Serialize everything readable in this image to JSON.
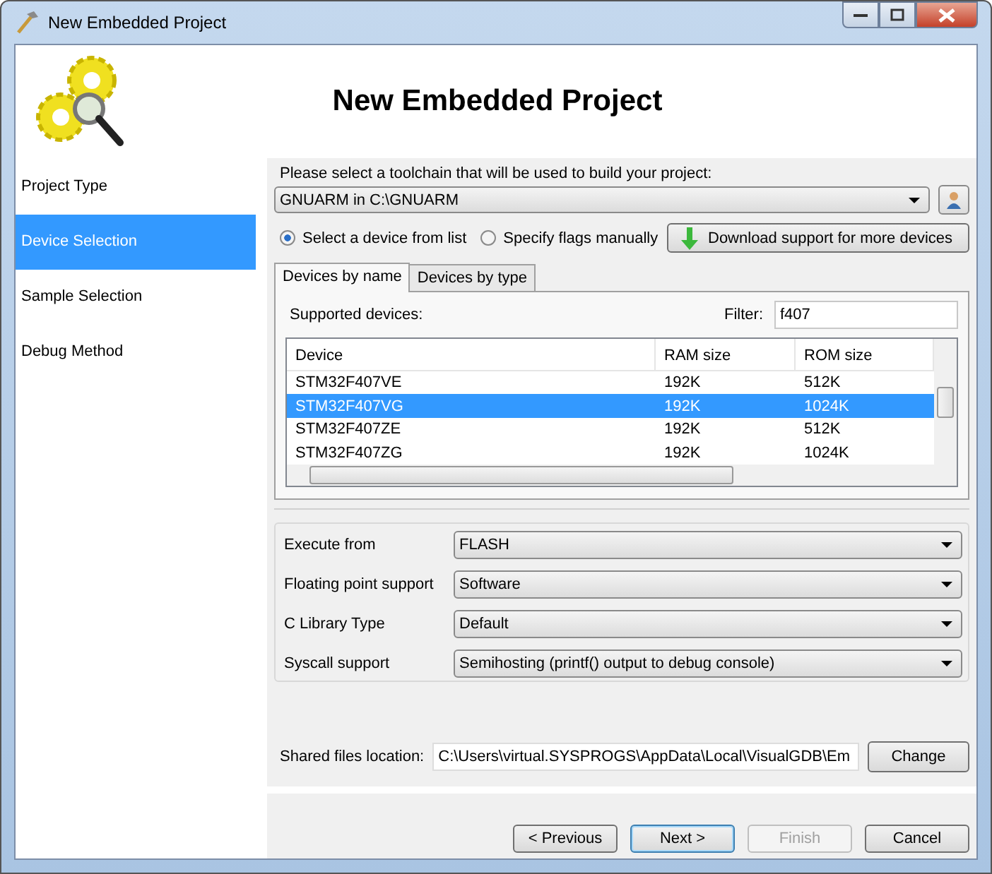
{
  "window": {
    "title": "New Embedded Project"
  },
  "header": {
    "title": "New Embedded Project"
  },
  "sidebar": {
    "items": [
      {
        "label": "Project Type",
        "selected": false
      },
      {
        "label": "Device Selection",
        "selected": true
      },
      {
        "label": "Sample Selection",
        "selected": false
      },
      {
        "label": "Debug Method",
        "selected": false
      }
    ]
  },
  "toolchain": {
    "prompt": "Please select a toolchain that will be used to build your project:",
    "value": "GNUARM in C:\\GNUARM"
  },
  "mode_options": [
    {
      "label": "Select a device from list",
      "selected": true
    },
    {
      "label": "Specify flags manually",
      "selected": false
    }
  ],
  "download_button": "Download support for more devices",
  "device_tabs": [
    {
      "label": "Devices by name",
      "selected": true
    },
    {
      "label": "Devices by type",
      "selected": false
    }
  ],
  "supported_label": "Supported devices:",
  "filter": {
    "label": "Filter:",
    "value": "f407"
  },
  "table": {
    "columns": [
      "Device",
      "RAM size",
      "ROM size"
    ],
    "rows": [
      {
        "cells": [
          "STM32F407VE",
          "192K",
          "512K"
        ],
        "selected": false
      },
      {
        "cells": [
          "STM32F407VG",
          "192K",
          "1024K"
        ],
        "selected": true
      },
      {
        "cells": [
          "STM32F407ZE",
          "192K",
          "512K"
        ],
        "selected": false
      },
      {
        "cells": [
          "STM32F407ZG",
          "192K",
          "1024K"
        ],
        "selected": false
      }
    ]
  },
  "settings": [
    {
      "label": "Execute from",
      "value": "FLASH"
    },
    {
      "label": "Floating point support",
      "value": "Software"
    },
    {
      "label": "C Library Type",
      "value": "Default"
    },
    {
      "label": "Syscall support",
      "value": "Semihosting (printf() output to debug console)"
    }
  ],
  "shared_files": {
    "label": "Shared files location:",
    "value": "C:\\Users\\virtual.SYSPROGS\\AppData\\Local\\VisualGDB\\Em",
    "button": "Change"
  },
  "buttons": [
    {
      "label": "< Previous",
      "disabled": false,
      "default": false
    },
    {
      "label": "Next >",
      "disabled": false,
      "default": true
    },
    {
      "label": "Finish",
      "disabled": true,
      "default": false
    },
    {
      "label": "Cancel",
      "disabled": false,
      "default": false
    }
  ]
}
